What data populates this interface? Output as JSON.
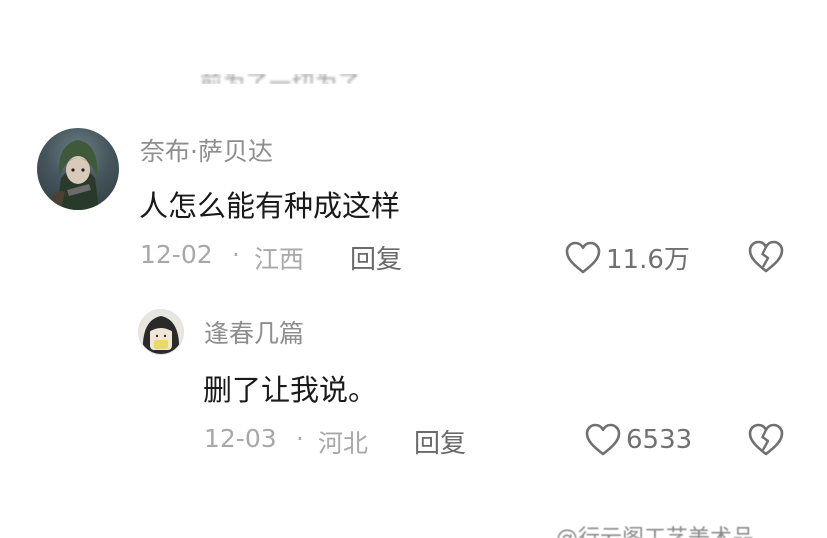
{
  "cutoff_text": "前为了一切为了",
  "comments": [
    {
      "author": "奈布·萨贝达",
      "text": "人怎么能有种成这样",
      "date": "12-02",
      "location": "江西",
      "reply_label": "回复",
      "likes": "11.6万",
      "separator": "·"
    }
  ],
  "replies": [
    {
      "author": "逢春几篇",
      "text": "删了让我说。",
      "date": "12-03",
      "location": "河北",
      "reply_label": "回复",
      "likes": "6533",
      "separator": "·"
    }
  ],
  "icons": {
    "like": "heart-outline-icon",
    "dislike": "broken-heart-icon"
  },
  "colors": {
    "text_primary": "#1a1a1a",
    "text_secondary": "#8e8e8e",
    "text_meta": "#a8a8a8"
  },
  "watermark": "@行云阁工艺美术品"
}
